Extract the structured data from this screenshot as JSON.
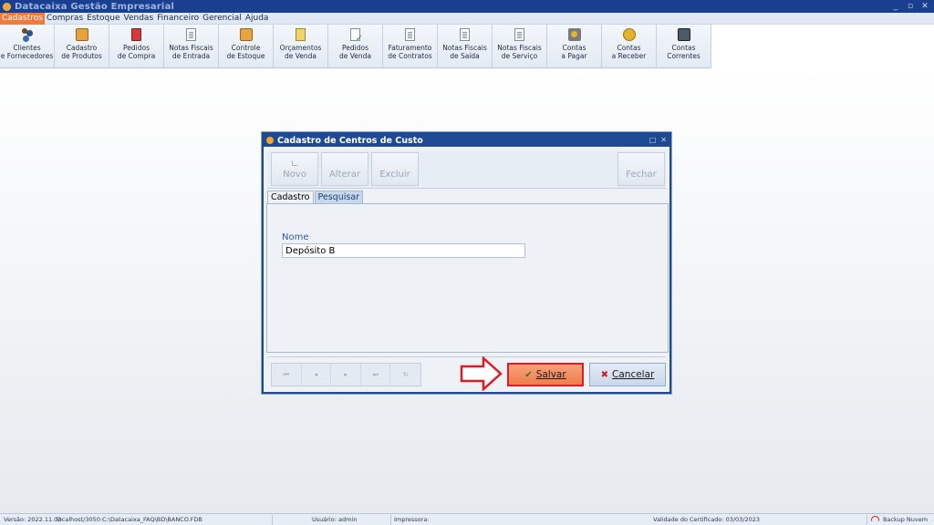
{
  "window": {
    "title": "Datacaixa Gestão Empresarial",
    "controls": [
      "_",
      "▫",
      "✕"
    ]
  },
  "menu": [
    {
      "label": "Cadastros",
      "active": true
    },
    {
      "label": "Compras"
    },
    {
      "label": "Estoque"
    },
    {
      "label": "Vendas"
    },
    {
      "label": "Financeiro"
    },
    {
      "label": "Gerencial"
    },
    {
      "label": "Ajuda"
    }
  ],
  "toolbar": [
    {
      "label": "Clientes\ne Fornecedores",
      "icon": "people-icon"
    },
    {
      "label": "Cadastro\nde Produtos",
      "icon": "box-icon"
    },
    {
      "label": "Pedidos\nde Compra",
      "icon": "book-icon"
    },
    {
      "label": "Notas Fiscais\nde Entrada",
      "icon": "document-icon"
    },
    {
      "label": "Controle\nde Estoque",
      "icon": "box-icon"
    },
    {
      "label": "Orçamentos\nde Venda",
      "icon": "clipboard-icon"
    },
    {
      "label": "Pedidos\nde Venda",
      "icon": "check-document-icon"
    },
    {
      "label": "Faturamento\nde Contratos",
      "icon": "document-icon"
    },
    {
      "label": "Notas Fiscais\nde Saída",
      "icon": "document-icon"
    },
    {
      "label": "Notas Fiscais\nde Serviço",
      "icon": "document-icon"
    },
    {
      "label": "Contas\na Pagar",
      "icon": "cash-icon"
    },
    {
      "label": "Contas\na Receber",
      "icon": "coins-icon"
    },
    {
      "label": "Contas\nCorrentes",
      "icon": "safe-icon"
    }
  ],
  "dialog": {
    "title": "Cadastro de Centros de Custo",
    "controls": [
      "□",
      "✕"
    ],
    "buttons": {
      "novo": "Novo",
      "alterar": "Alterar",
      "excluir": "Excluir",
      "fechar": "Fechar"
    },
    "tabs": {
      "cadastro": "Cadastro",
      "pesquisar": "Pesquisar"
    },
    "field": {
      "label": "Nome",
      "value": "Depósito B"
    },
    "nav": [
      "⏮",
      "◂",
      "▸",
      "⏭",
      "↻"
    ],
    "save_label": "Salvar",
    "cancel_label": "Cancelar"
  },
  "status": {
    "version": "Versão: 2022.11.03",
    "database": "localhost/3050:C:\\Datacaixa_FAQ\\BD\\BANCO.FDB",
    "user": "Usuário: admin",
    "printer": "Impressora:",
    "certificate": "Validade do Certificado: 03/03/2023",
    "backup": "Backup Nuvem"
  },
  "colors": {
    "titlebar": "#1a3f8f",
    "menu_active": "#f07a3c",
    "save_button": "#f07d4a",
    "highlight_border": "#d81f2a"
  }
}
